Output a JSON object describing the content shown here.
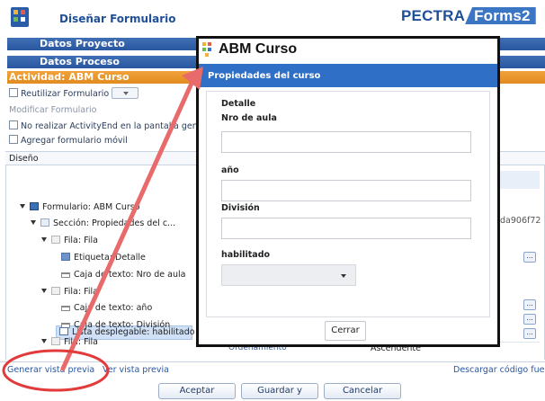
{
  "header": {
    "title": "Diseñar Formulario",
    "brand_left": "PECTRA",
    "brand_right": "Forms2"
  },
  "sections": {
    "datos_proyecto": "Datos Proyecto",
    "datos_proceso": "Datos Proceso",
    "actividad": "Actividad: ABM Curso"
  },
  "options": {
    "reutilizar": "Reutilizar Formulario",
    "modificar": "Modificar Formulario",
    "no_activity_end": "No realizar ActivityEnd en la pantalla gene",
    "agregar_movil": "Agregar formulario móvil"
  },
  "design": {
    "heading": "Diseño",
    "tree": [
      "Formulario: ABM Curso",
      "Sección: Propiedades del c...",
      "Fila: Fila",
      "Etiqueta: Detalle",
      "Caja de texto: Nro de aula",
      "Fila: Fila",
      "Caja de texto: año",
      "Caja de texto: División",
      "Fila: Fila",
      "Lista desplegable: habilitado"
    ],
    "guid_fragment": "da906f72",
    "prop_key": "Ordenamiento",
    "prop_value": "Ascendente"
  },
  "footer": {
    "generar": "Generar vista previa",
    "ver": "Ver vista previa",
    "descargar": "Descargar código fuent",
    "aceptar": "Aceptar",
    "guardar": "Guardar y Cerrar",
    "cancelar": "Cancelar"
  },
  "modal": {
    "title": "ABM Curso",
    "section": "Propiedades del curso",
    "detalle": "Detalle",
    "nro_aula": "Nro de aula",
    "anio": "año",
    "division": "División",
    "habilitado": "habilitado",
    "cerrar": "Cerrar"
  },
  "colors": {
    "primary_blue": "#2f6fc6",
    "header_blue": "#1f4f99",
    "orange": "#e08b1f",
    "annotation_red": "#e23b3b"
  }
}
